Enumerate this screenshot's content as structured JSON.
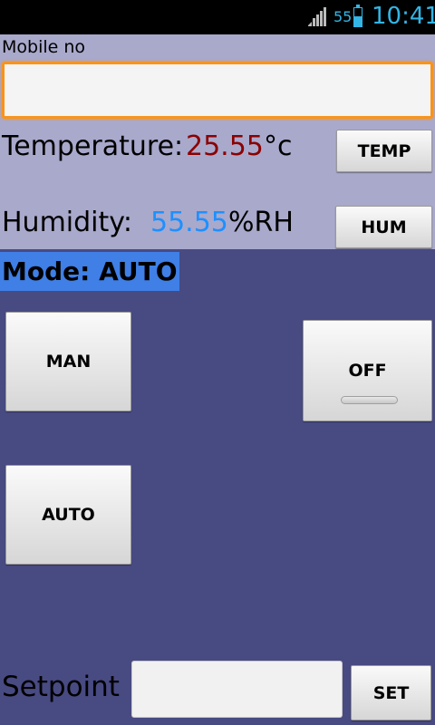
{
  "status_bar": {
    "battery_level": "55",
    "battery_fraction": 0.55,
    "time": "10:41",
    "accent_color": "#33b5e5",
    "icons": [
      "signal-icon",
      "battery-icon"
    ]
  },
  "mobile": {
    "label": "Mobile no",
    "value": "",
    "placeholder": ""
  },
  "temperature": {
    "label": "Temperature:",
    "value": "25.55",
    "unit": "°c",
    "button": "TEMP",
    "value_color": "#8b0000"
  },
  "humidity": {
    "label": "Humidity:",
    "value": "55.55",
    "unit": "%RH",
    "button": "HUM",
    "value_color": "#1e90ff"
  },
  "mode": {
    "label": "Mode: AUTO",
    "highlight_color": "#3f7fe6"
  },
  "controls": {
    "man_button": "MAN",
    "off_button": "OFF",
    "auto_button": "AUTO"
  },
  "setpoint": {
    "label": "Setpoint",
    "value": "",
    "button": "SET"
  },
  "colors": {
    "top_background": "#a9a9cc",
    "bottom_background": "#484a82",
    "focus_border": "#f7941d"
  }
}
